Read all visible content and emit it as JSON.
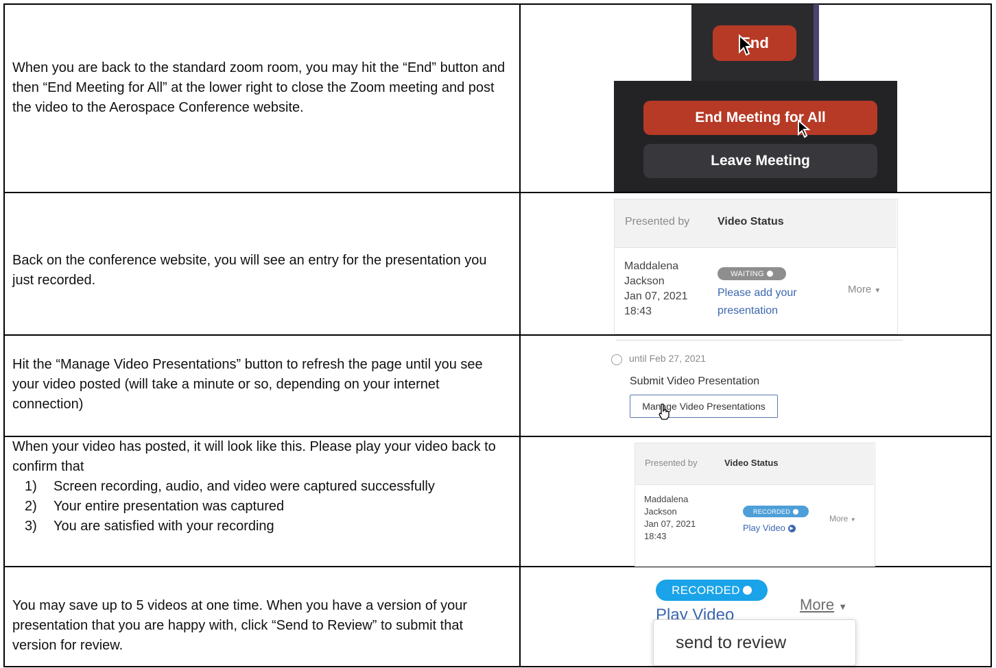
{
  "rows": [
    {
      "text": "When you are back to the standard zoom room, you may hit the “End” button and then “End Meeting for All” at the lower right to close the Zoom meeting and post the video to the Aerospace Conference website.",
      "zoom": {
        "end_label": "End",
        "end_all_label": "End Meeting for All",
        "leave_label": "Leave Meeting"
      }
    },
    {
      "text": "Back on the conference website, you will see an entry for the presentation you just recorded.",
      "status": {
        "col_presented": "Presented by",
        "col_status": "Video Status",
        "name_first": "Maddalena",
        "name_last": "Jackson",
        "date": "Jan 07, 2021",
        "time": "18:43",
        "badge": "WAITING",
        "link_line1": "Please add your",
        "link_line2": "presentation",
        "more": "More"
      }
    },
    {
      "text": "Hit the “Manage Video Presentations” button to refresh the page until you see your video posted (will take a minute or so, depending on your internet connection)",
      "manage": {
        "until": "until Feb 27, 2021",
        "title": "Submit Video Presentation",
        "button": "Manage Video Presentations"
      }
    },
    {
      "intro": "When your video has posted, it will look like this. Please play your video back to confirm that",
      "steps": [
        {
          "num": "1)",
          "text": "Screen recording, audio, and video were captured successfully"
        },
        {
          "num": "2)",
          "text": "Your entire presentation was captured"
        },
        {
          "num": "3)",
          "text": "You are satisfied with your recording"
        }
      ],
      "status": {
        "col_presented": "Presented by",
        "col_status": "Video Status",
        "name_first": "Maddalena",
        "name_last": "Jackson",
        "date": "Jan 07, 2021",
        "time": "18:43",
        "badge": "RECORDED",
        "play": "Play Video",
        "more": "More"
      }
    },
    {
      "text": "You may save up to 5 videos at one time.  When you have a version of your presentation that you are happy with, click “Send to Review” to submit that version for review.",
      "review": {
        "badge": "RECORDED",
        "play": "Play Video",
        "more": "More",
        "menu_item": "send to review"
      }
    }
  ],
  "colors": {
    "zoom_red": "#b73a26",
    "zoom_dark": "#232326",
    "link_blue": "#3a67b0",
    "waiting_gray": "#8e8e8e",
    "recorded_blue": "#4e9fd8",
    "recorded_bright": "#1aa3e8"
  }
}
